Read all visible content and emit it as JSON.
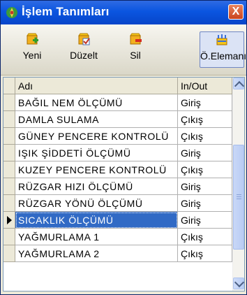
{
  "window": {
    "title": "İşlem Tanımları",
    "close_label": "X"
  },
  "toolbar": {
    "buttons": [
      {
        "label": "Yeni",
        "icon": "new-icon"
      },
      {
        "label": "Düzelt",
        "icon": "edit-icon"
      },
      {
        "label": "Sil",
        "icon": "delete-icon"
      },
      {
        "label": "Ö.Elemanı",
        "icon": "element-icon"
      }
    ]
  },
  "grid": {
    "columns": [
      "Adı",
      "In/Out"
    ],
    "rows": [
      {
        "name": "BAĞIL NEM ÖLÇÜMÜ",
        "io": "Giriş"
      },
      {
        "name": "DAMLA SULAMA",
        "io": "Çıkış"
      },
      {
        "name": "GÜNEY PENCERE KONTROLÜ",
        "io": "Çıkış"
      },
      {
        "name": "IŞIK ŞİDDETİ ÖLÇÜMÜ",
        "io": "Giriş"
      },
      {
        "name": "KUZEY PENCERE KONTROLÜ",
        "io": "Çıkış"
      },
      {
        "name": "RÜZGAR HIZI ÖLÇÜMÜ",
        "io": "Giriş"
      },
      {
        "name": "RÜZGAR YÖNÜ ÖLÇÜMÜ",
        "io": "Giriş"
      },
      {
        "name": "SICAKLIK ÖLÇÜMÜ",
        "io": "Giriş"
      },
      {
        "name": "YAĞMURLAMA 1",
        "io": "Çıkış"
      },
      {
        "name": "YAĞMURLAMA 2",
        "io": "Çıkış"
      }
    ],
    "selected_index": 7
  },
  "colors": {
    "title_bar": "#0a55e0",
    "selection": "#316ac5",
    "close_button": "#c9431d"
  }
}
